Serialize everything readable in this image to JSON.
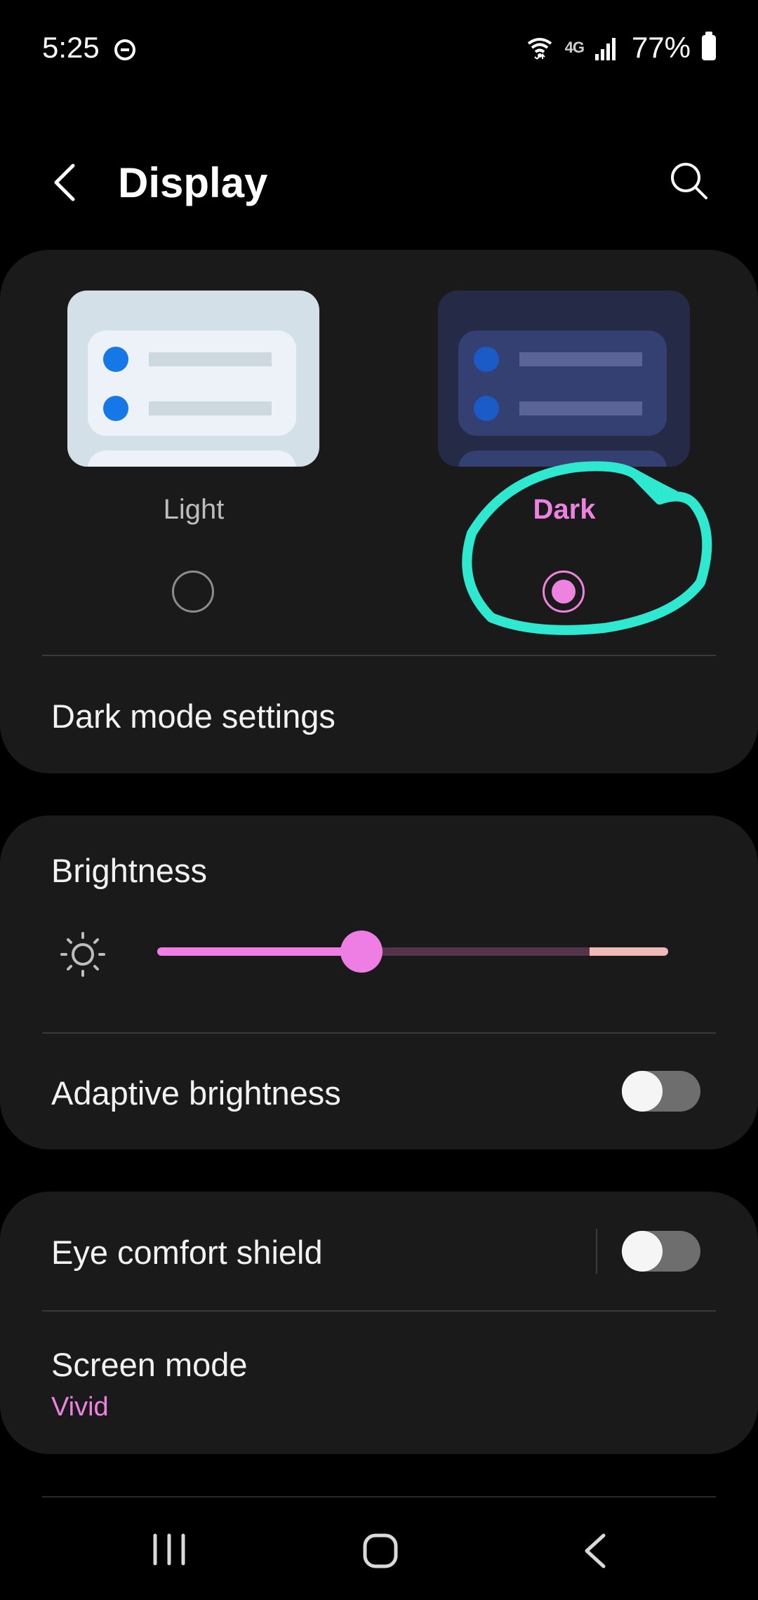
{
  "status_bar": {
    "time": "5:25",
    "network": "4G",
    "battery": "77%",
    "icons": [
      "do-not-disturb-icon",
      "wifi-icon",
      "signal-icon",
      "battery-icon"
    ]
  },
  "header": {
    "title": "Display",
    "icons": [
      "back-icon",
      "search-icon"
    ]
  },
  "theme": {
    "options": [
      {
        "label": "Light",
        "selected": false
      },
      {
        "label": "Dark",
        "selected": true
      }
    ],
    "dark_mode_settings_label": "Dark mode settings"
  },
  "brightness": {
    "label": "Brightness",
    "level": 0.4,
    "adaptive_label": "Adaptive brightness",
    "adaptive_on": false
  },
  "eye_comfort": {
    "label": "Eye comfort shield",
    "on": false
  },
  "screen_mode": {
    "label": "Screen mode",
    "value": "Vivid"
  },
  "colors": {
    "accent": "#ee82e0",
    "card": "#1a1a1a",
    "annotation": "#2fe8d0"
  },
  "nav_bar": {
    "icons": [
      "recents-icon",
      "home-icon",
      "back-icon"
    ]
  }
}
